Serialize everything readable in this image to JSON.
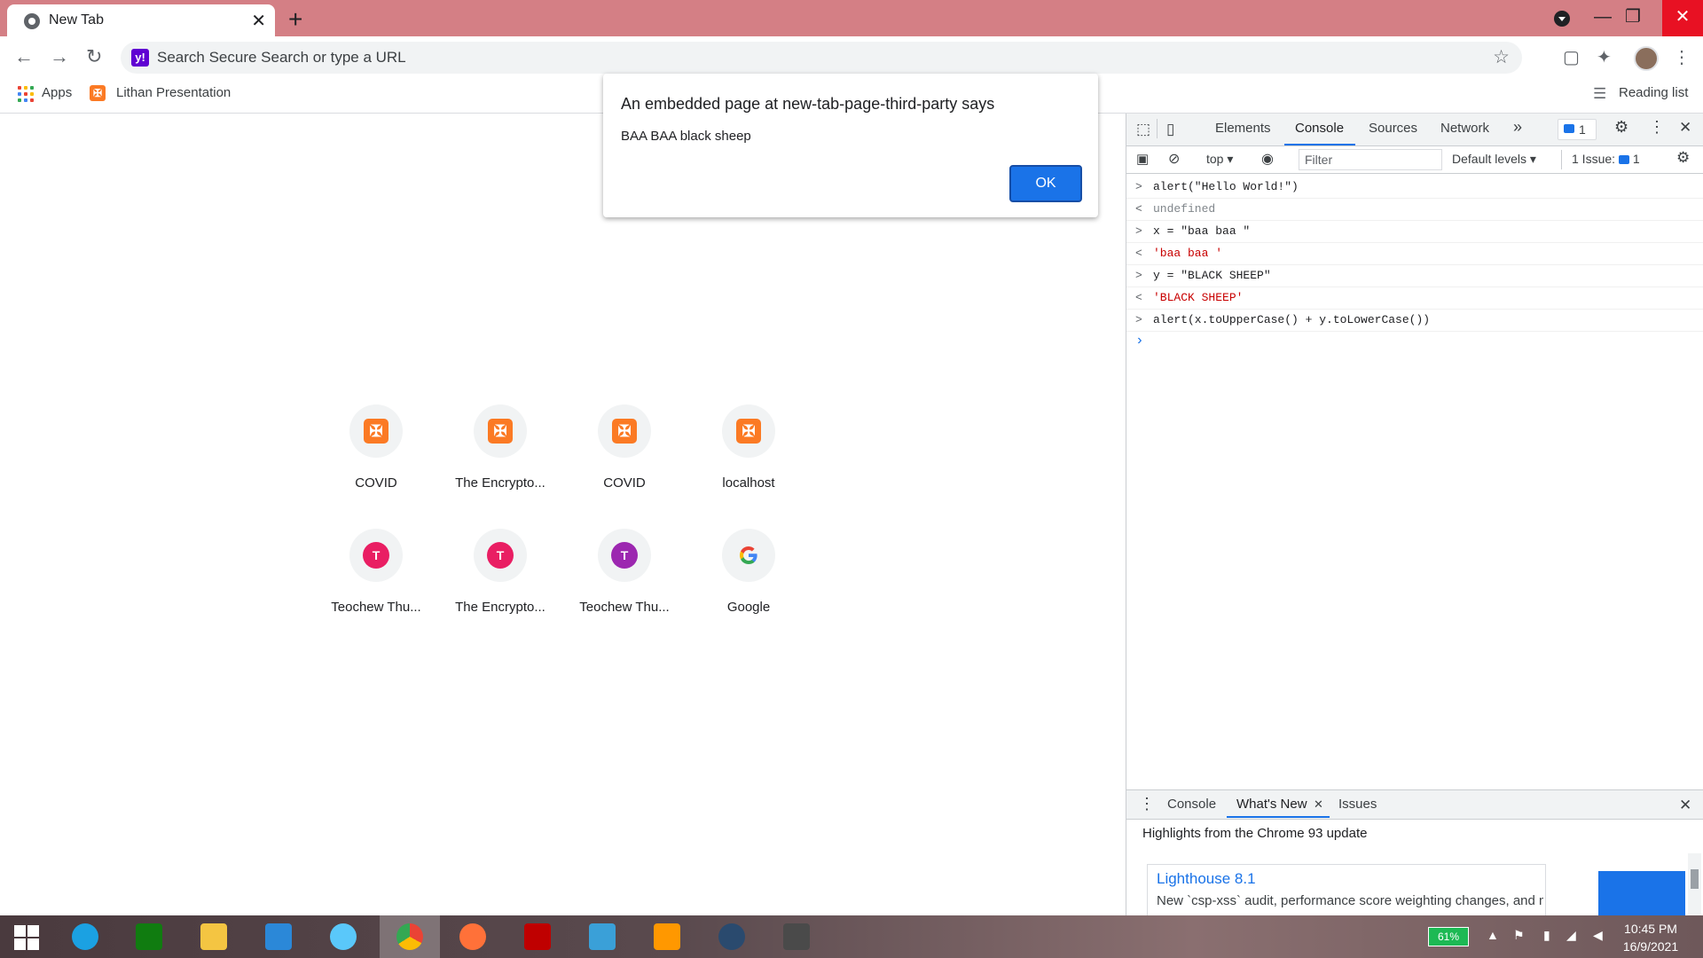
{
  "browser": {
    "tab_title": "New Tab",
    "tab_close": "✕",
    "new_tab": "+",
    "omnibox_placeholder": "Search Secure Search or type a URL",
    "omnibox_badge": "y!",
    "bookmarks": [
      {
        "label": "Apps"
      },
      {
        "label": "Lithan Presentation"
      }
    ],
    "reading_list": "Reading list"
  },
  "ntp": {
    "tiles": [
      {
        "label": "COVID",
        "icon": "xampp-icon"
      },
      {
        "label": "The Encrypto...",
        "icon": "xampp-icon"
      },
      {
        "label": "COVID",
        "icon": "xampp-icon"
      },
      {
        "label": "localhost",
        "icon": "xampp-icon"
      },
      {
        "label": "Teochew Thu...",
        "icon": "letter-icon",
        "letter": "T",
        "color": "#e91e63"
      },
      {
        "label": "The Encrypto...",
        "icon": "letter-icon",
        "letter": "T",
        "color": "#e91e63"
      },
      {
        "label": "Teochew Thu...",
        "icon": "letter-icon",
        "letter": "T",
        "color": "#9c27b0"
      },
      {
        "label": "Google",
        "icon": "google-icon"
      }
    ]
  },
  "alert": {
    "title": "An embedded page at new-tab-page-third-party says",
    "message": "BAA BAA black sheep",
    "ok": "OK"
  },
  "devtools": {
    "tabs": [
      "Elements",
      "Console",
      "Sources",
      "Network"
    ],
    "active_tab": "Console",
    "more": "»",
    "issues_badge": "1",
    "context": "top",
    "filter_placeholder": "Filter",
    "levels": "Default levels",
    "issues_label": "1 Issue:",
    "issues_count": "1",
    "console_lines": [
      {
        "dir": ">",
        "text": "alert(\"Hello World!\")",
        "kind": "input"
      },
      {
        "dir": "<",
        "text": "undefined",
        "kind": "gray"
      },
      {
        "dir": ">",
        "text": "x = \"baa baa \"",
        "kind": "input"
      },
      {
        "dir": "<",
        "text": "'baa baa '",
        "kind": "str"
      },
      {
        "dir": ">",
        "text": "y = \"BLACK SHEEP\"",
        "kind": "input"
      },
      {
        "dir": "<",
        "text": "'BLACK SHEEP'",
        "kind": "str"
      },
      {
        "dir": ">",
        "text": "alert(x.toUpperCase() + y.toLowerCase())",
        "kind": "input"
      }
    ],
    "prompt": "›",
    "drawer": {
      "tabs": [
        "Console",
        "What's New",
        "Issues"
      ],
      "active_tab": "What's New",
      "headline": "Highlights from the Chrome 93 update",
      "card_title": "Lighthouse 8.1",
      "card_desc": "New `csp-xss` audit, performance score weighting changes, and more."
    }
  },
  "taskbar": {
    "battery": "61%",
    "time": "10:45 PM",
    "date": "16/9/2021",
    "apps": [
      "ie-icon",
      "store-icon",
      "file-explorer-icon",
      "remote-desktop-icon",
      "safari-icon",
      "chrome-icon",
      "firefox-icon",
      "filezilla-icon",
      "feather-icon",
      "sublime-icon",
      "tree-app-icon",
      "sublime-alt-icon"
    ]
  },
  "colors": {
    "titlebar": "#d47f85",
    "accent": "#1a73e8",
    "xampp": "#fb7a24"
  }
}
